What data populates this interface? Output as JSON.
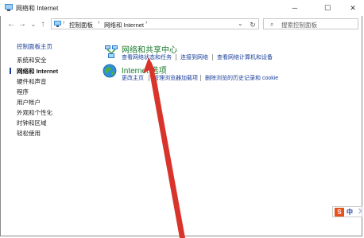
{
  "window": {
    "title": "网络和 Internet",
    "minimize": "─",
    "maximize": "☐",
    "close": "✕"
  },
  "toolbar": {
    "back": "←",
    "forward": "→",
    "up": "↑",
    "recent": "⌄",
    "breadcrumbs": [
      "控制面板",
      "网络和 Internet"
    ],
    "separator": "›",
    "dropdown": "⌄",
    "refresh": "↻",
    "search_icon": "🔍",
    "search_placeholder": "搜索控制面板"
  },
  "sidebar": {
    "items": [
      {
        "label": "控制面板主页",
        "type": "link"
      },
      {
        "label": "系统和安全",
        "type": "normal"
      },
      {
        "label": "网络和 Internet",
        "type": "current"
      },
      {
        "label": "硬件和声音",
        "type": "normal"
      },
      {
        "label": "程序",
        "type": "normal"
      },
      {
        "label": "用户帐户",
        "type": "normal"
      },
      {
        "label": "外观和个性化",
        "type": "normal"
      },
      {
        "label": "时钟和区域",
        "type": "normal"
      },
      {
        "label": "轻松使用",
        "type": "normal"
      }
    ]
  },
  "groups": [
    {
      "title": "网络和共享中心",
      "icon": "network-center-icon",
      "tasks": [
        "查看网络状态和任务",
        "连接到网络",
        "查看网络计算机和设备"
      ]
    },
    {
      "title": "Internet 选项",
      "icon": "internet-options-icon",
      "tasks": [
        "更改主页",
        "管理浏览器加载项",
        "删除浏览的历史记录和 cookie"
      ]
    }
  ],
  "ime": {
    "logo": "S",
    "label": "中",
    "moon": "☽"
  },
  "colors": {
    "group_title": "#1a7a2e",
    "link": "#1a3e9a",
    "annotation_arrow": "#d8342c"
  }
}
